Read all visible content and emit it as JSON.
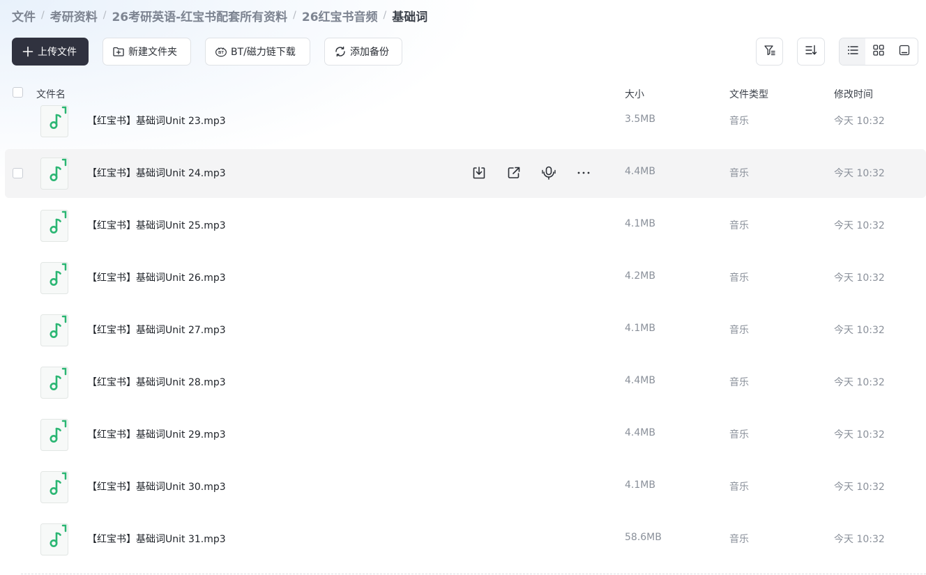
{
  "breadcrumb": [
    {
      "label": "文件"
    },
    {
      "label": "考研资料"
    },
    {
      "label": "26考研英语-红宝书配套所有资料"
    },
    {
      "label": "26红宝书音频"
    },
    {
      "label": "基础词"
    }
  ],
  "toolbar": {
    "upload_label": "上传文件",
    "new_folder_label": "新建文件夹",
    "bt_label": "BT/磁力链下载",
    "backup_label": "添加备份"
  },
  "table": {
    "columns": {
      "name": "文件名",
      "size": "大小",
      "type": "文件类型",
      "modified": "修改时间"
    },
    "rows": [
      {
        "name": "【红宝书】基础词Unit 23.mp3",
        "size": "3.5MB",
        "type": "音乐",
        "modified": "今天 10:32"
      },
      {
        "name": "【红宝书】基础词Unit 24.mp3",
        "size": "4.4MB",
        "type": "音乐",
        "modified": "今天 10:32"
      },
      {
        "name": "【红宝书】基础词Unit 25.mp3",
        "size": "4.1MB",
        "type": "音乐",
        "modified": "今天 10:32"
      },
      {
        "name": "【红宝书】基础词Unit 26.mp3",
        "size": "4.2MB",
        "type": "音乐",
        "modified": "今天 10:32"
      },
      {
        "name": "【红宝书】基础词Unit 27.mp3",
        "size": "4.1MB",
        "type": "音乐",
        "modified": "今天 10:32"
      },
      {
        "name": "【红宝书】基础词Unit 28.mp3",
        "size": "4.4MB",
        "type": "音乐",
        "modified": "今天 10:32"
      },
      {
        "name": "【红宝书】基础词Unit 29.mp3",
        "size": "4.4MB",
        "type": "音乐",
        "modified": "今天 10:32"
      },
      {
        "name": "【红宝书】基础词Unit 30.mp3",
        "size": "4.1MB",
        "type": "音乐",
        "modified": "今天 10:32"
      },
      {
        "name": "【红宝书】基础词Unit 31.mp3",
        "size": "58.6MB",
        "type": "音乐",
        "modified": "今天 10:32"
      }
    ]
  },
  "icons": {
    "file": "music-note-icon",
    "row_actions": [
      "download-icon",
      "share-icon",
      "audio-transcribe-icon",
      "more-icon"
    ],
    "toolbar_right": [
      "filter-icon",
      "sort-icon"
    ],
    "views": [
      "list-view-icon",
      "grid-view-icon",
      "preview-view-icon"
    ]
  },
  "colors": {
    "accent_green": "#2bb673",
    "primary_button": "#30323f"
  }
}
